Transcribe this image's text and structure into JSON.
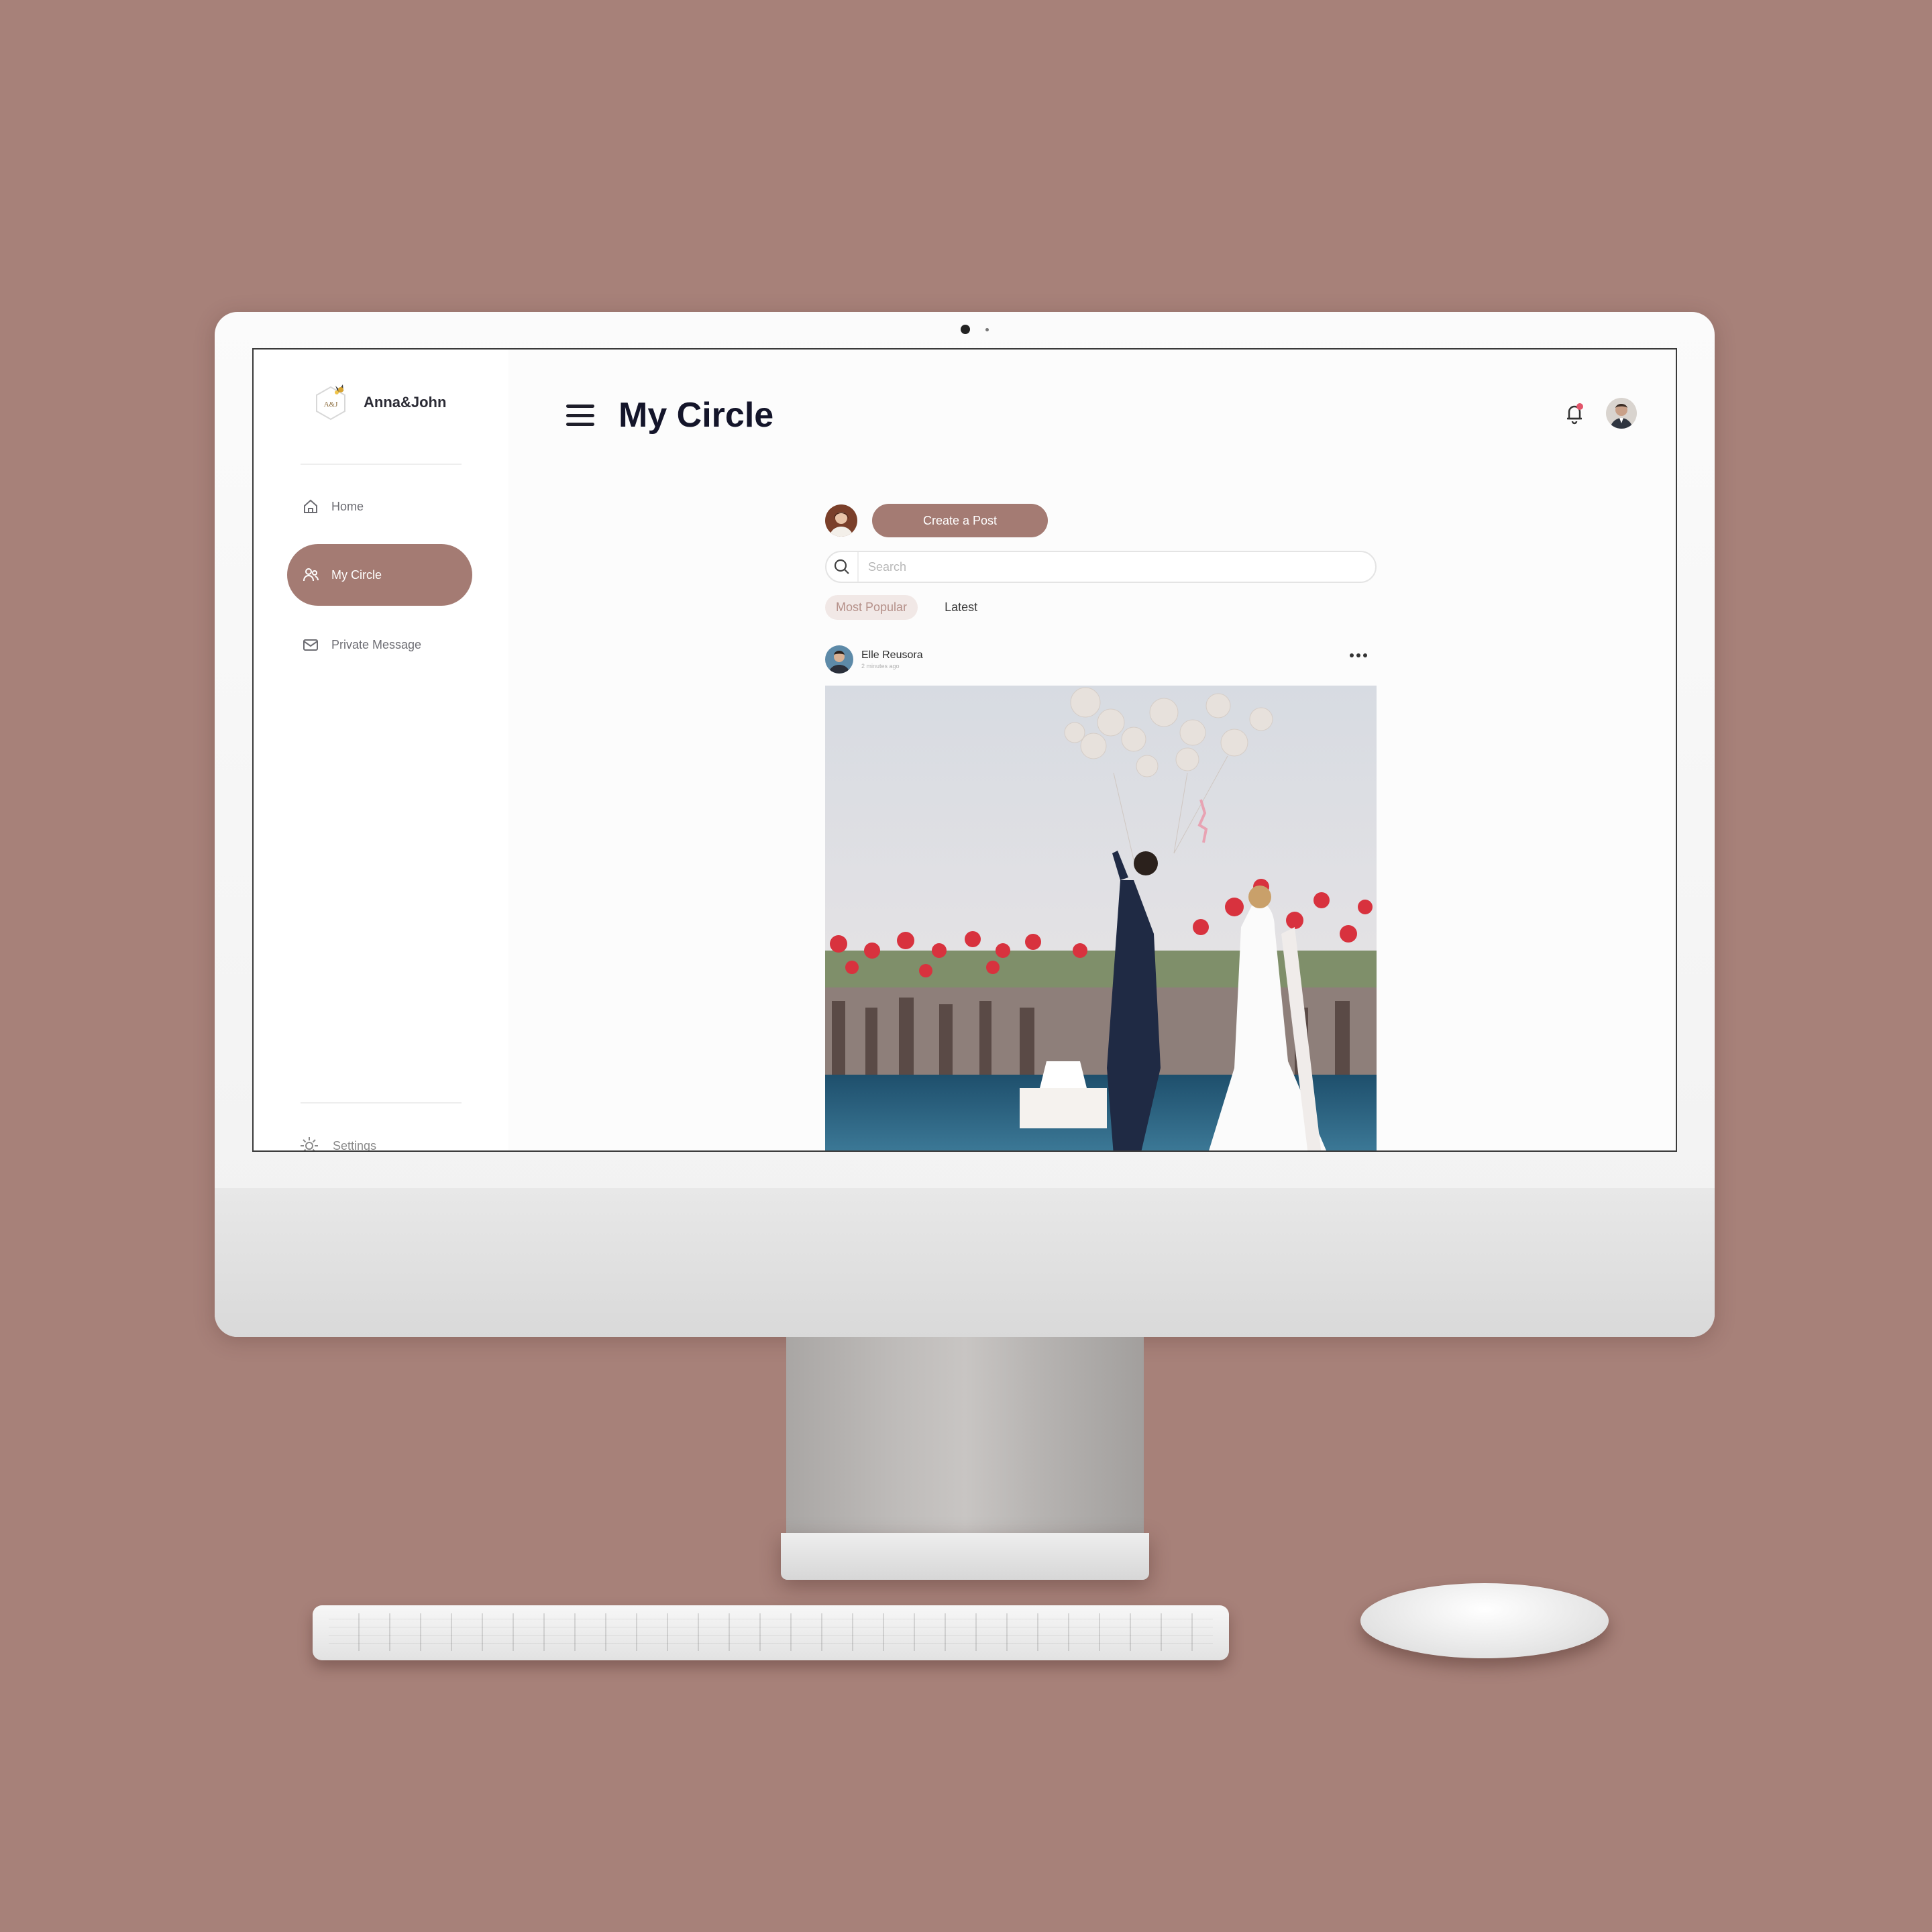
{
  "brand": {
    "name": "Anna&John",
    "logo_text": "A&J"
  },
  "sidebar": {
    "items": [
      {
        "label": "Home",
        "icon": "home-icon"
      },
      {
        "label": "My Circle",
        "icon": "users-icon",
        "active": true
      },
      {
        "label": "Private Message",
        "icon": "mail-icon"
      }
    ],
    "settings_label": "Settings"
  },
  "header": {
    "title": "My Circle"
  },
  "composer": {
    "create_label": "Create a Post"
  },
  "search": {
    "placeholder": "Search"
  },
  "tabs": [
    {
      "label": "Most Popular",
      "active": true
    },
    {
      "label": "Latest",
      "active": false
    }
  ],
  "post": {
    "author": "Elle Reusora",
    "time": "2 minutes ago"
  },
  "colors": {
    "background": "#a78179",
    "accent": "#a47b73",
    "title": "#14152a",
    "notification": "#e2546a"
  }
}
